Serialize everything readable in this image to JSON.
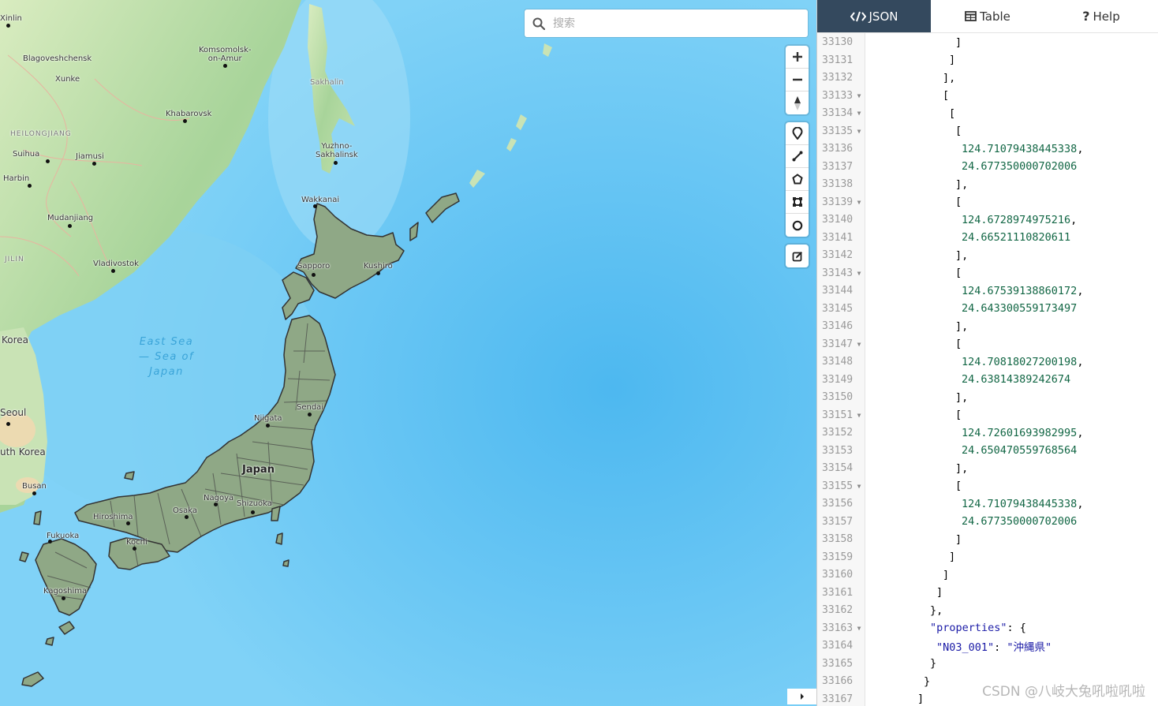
{
  "map": {
    "search": {
      "placeholder": "搜索"
    },
    "places": {
      "xinlin": "Xinlin",
      "blagoveshchensk": "Blagoveshchensk",
      "komsomolsk": "Komsomolsk-\non-Amur",
      "xunke": "Xunke",
      "khabarovsk": "Khabarovsk",
      "heilongjiang": "HEILONGJIANG",
      "suihua": "Suihua",
      "jiamusi": "Jiamusi",
      "harbin": "Harbin",
      "mudanjiang": "Mudanjiang",
      "jilin": "JILIN",
      "vladivostok": "Vladivostok",
      "sakhalin": "Sakhalin",
      "yuzhno": "Yuzhno-\nSakhalinsk",
      "wakkanai": "Wakkanai",
      "sapporo": "Sapporo",
      "kushiro": "Kushiro",
      "korea": "Korea",
      "east_sea": "East Sea\n— Sea of\nJapan",
      "sendai": "Sendai",
      "niigata": "Niigata",
      "japan": "Japan",
      "seoul": "Seoul",
      "south_korea": "uth Korea",
      "busan": "Busan",
      "nagoya": "Nagoya",
      "shizuoka": "Shizuoka",
      "hiroshima": "Hiroshima",
      "osaka": "Osaka",
      "fukuoka": "Fukuoka",
      "kochi": "Kochi",
      "kagoshima": "Kagoshima"
    },
    "controls": [
      {
        "name": "zoom-in-icon"
      },
      {
        "name": "zoom-out-icon"
      },
      {
        "name": "compass-icon"
      },
      {
        "name": "draw-marker-icon"
      },
      {
        "name": "draw-line-icon"
      },
      {
        "name": "draw-polygon-icon"
      },
      {
        "name": "draw-rectangle-icon"
      },
      {
        "name": "draw-circle-icon"
      },
      {
        "name": "edit-layers-icon"
      }
    ]
  },
  "panel": {
    "tabs": [
      {
        "label": "JSON",
        "icon": "code-icon",
        "active": true
      },
      {
        "label": "Table",
        "icon": "table-icon",
        "active": false
      },
      {
        "label": "Help",
        "icon": "question-icon",
        "active": false
      }
    ],
    "lines": [
      {
        "n": "33130",
        "fold": false,
        "indent": 13,
        "text": "]"
      },
      {
        "n": "33131",
        "fold": false,
        "indent": 12,
        "text": "]"
      },
      {
        "n": "33132",
        "fold": false,
        "indent": 11,
        "text": "],"
      },
      {
        "n": "33133",
        "fold": true,
        "indent": 11,
        "text": "["
      },
      {
        "n": "33134",
        "fold": true,
        "indent": 12,
        "text": "["
      },
      {
        "n": "33135",
        "fold": true,
        "indent": 13,
        "text": "["
      },
      {
        "n": "33136",
        "fold": false,
        "indent": 14,
        "num": "124.71079438445338",
        "trail": ","
      },
      {
        "n": "33137",
        "fold": false,
        "indent": 14,
        "num": "24.677350000702006",
        "trail": ""
      },
      {
        "n": "33138",
        "fold": false,
        "indent": 13,
        "text": "],"
      },
      {
        "n": "33139",
        "fold": true,
        "indent": 13,
        "text": "["
      },
      {
        "n": "33140",
        "fold": false,
        "indent": 14,
        "num": "124.6728974975216",
        "trail": ","
      },
      {
        "n": "33141",
        "fold": false,
        "indent": 14,
        "num": "24.66521110820611",
        "trail": ""
      },
      {
        "n": "33142",
        "fold": false,
        "indent": 13,
        "text": "],"
      },
      {
        "n": "33143",
        "fold": true,
        "indent": 13,
        "text": "["
      },
      {
        "n": "33144",
        "fold": false,
        "indent": 14,
        "num": "124.67539138860172",
        "trail": ","
      },
      {
        "n": "33145",
        "fold": false,
        "indent": 14,
        "num": "24.643300559173497",
        "trail": ""
      },
      {
        "n": "33146",
        "fold": false,
        "indent": 13,
        "text": "],"
      },
      {
        "n": "33147",
        "fold": true,
        "indent": 13,
        "text": "["
      },
      {
        "n": "33148",
        "fold": false,
        "indent": 14,
        "num": "124.70818027200198",
        "trail": ","
      },
      {
        "n": "33149",
        "fold": false,
        "indent": 14,
        "num": "24.63814389242674",
        "trail": ""
      },
      {
        "n": "33150",
        "fold": false,
        "indent": 13,
        "text": "],"
      },
      {
        "n": "33151",
        "fold": true,
        "indent": 13,
        "text": "["
      },
      {
        "n": "33152",
        "fold": false,
        "indent": 14,
        "num": "124.72601693982995",
        "trail": ","
      },
      {
        "n": "33153",
        "fold": false,
        "indent": 14,
        "num": "24.650470559768564",
        "trail": ""
      },
      {
        "n": "33154",
        "fold": false,
        "indent": 13,
        "text": "],"
      },
      {
        "n": "33155",
        "fold": true,
        "indent": 13,
        "text": "["
      },
      {
        "n": "33156",
        "fold": false,
        "indent": 14,
        "num": "124.71079438445338",
        "trail": ","
      },
      {
        "n": "33157",
        "fold": false,
        "indent": 14,
        "num": "24.677350000702006",
        "trail": ""
      },
      {
        "n": "33158",
        "fold": false,
        "indent": 13,
        "text": "]"
      },
      {
        "n": "33159",
        "fold": false,
        "indent": 12,
        "text": "]"
      },
      {
        "n": "33160",
        "fold": false,
        "indent": 11,
        "text": "]"
      },
      {
        "n": "33161",
        "fold": false,
        "indent": 10,
        "text": "]"
      },
      {
        "n": "33162",
        "fold": false,
        "indent": 9,
        "text": "},"
      },
      {
        "n": "33163",
        "fold": true,
        "indent": 9,
        "key": "\"properties\"",
        "text": ": {"
      },
      {
        "n": "33164",
        "fold": false,
        "indent": 10,
        "key": "\"N03_001\"",
        "text": ": ",
        "str": "\"沖縄県\""
      },
      {
        "n": "33165",
        "fold": false,
        "indent": 9,
        "text": "}"
      },
      {
        "n": "33166",
        "fold": false,
        "indent": 8,
        "text": "}"
      },
      {
        "n": "33167",
        "fold": false,
        "indent": 7,
        "text": "]"
      }
    ]
  },
  "watermark": "CSDN @八岐大兔吼啦吼啦"
}
